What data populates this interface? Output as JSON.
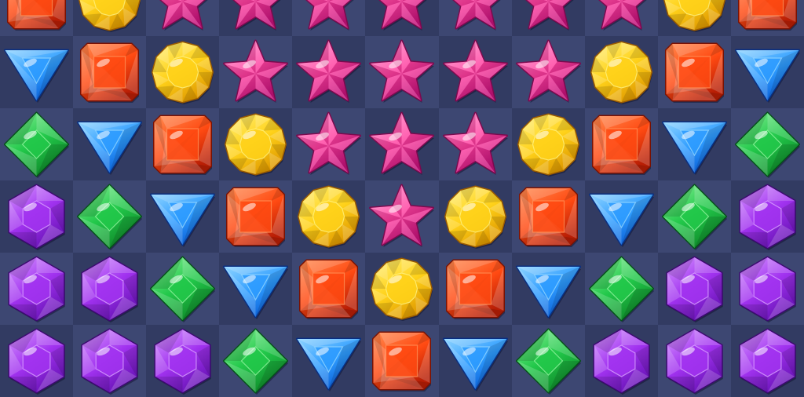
{
  "board": {
    "columns": 11,
    "rows": 6,
    "colors": {
      "cell_light": "#3d4772",
      "cell_dark": "#323b62",
      "background": "#2b3358"
    },
    "gem_types": {
      "red": {
        "icon": "red-square-gem-icon",
        "fill": "#ff4a12",
        "light": "#ff8a50",
        "dark": "#b81e05",
        "rim": "#7a1203"
      },
      "yellow": {
        "icon": "yellow-round-gem-icon",
        "fill": "#ffd21a",
        "light": "#fff07a",
        "dark": "#e09a00",
        "rim": "#9a5a00"
      },
      "pink": {
        "icon": "pink-star-gem-icon",
        "fill": "#ff3fa0",
        "light": "#ff9ad0",
        "dark": "#c4107a",
        "rim": "#7a0a4e"
      },
      "blue": {
        "icon": "blue-triangle-gem-icon",
        "fill": "#2e9cff",
        "light": "#8fd4ff",
        "dark": "#0b5ed6",
        "rim": "#0a2f80"
      },
      "green": {
        "icon": "green-diamond-gem-icon",
        "fill": "#22c84a",
        "light": "#8cf29a",
        "dark": "#0f8a2a",
        "rim": "#06501a"
      },
      "purple": {
        "icon": "purple-hexagon-gem-icon",
        "fill": "#a233f0",
        "light": "#d79bff",
        "dark": "#6a14b8",
        "rim": "#3c0a70"
      }
    },
    "grid": [
      [
        "red",
        "yellow",
        "pink",
        "pink",
        "pink",
        "pink",
        "pink",
        "pink",
        "pink",
        "yellow",
        "red"
      ],
      [
        "blue",
        "red",
        "yellow",
        "pink",
        "pink",
        "pink",
        "pink",
        "pink",
        "yellow",
        "red",
        "blue"
      ],
      [
        "green",
        "blue",
        "red",
        "yellow",
        "pink",
        "pink",
        "pink",
        "yellow",
        "red",
        "blue",
        "green"
      ],
      [
        "purple",
        "green",
        "blue",
        "red",
        "yellow",
        "pink",
        "yellow",
        "red",
        "blue",
        "green",
        "purple"
      ],
      [
        "purple",
        "purple",
        "green",
        "blue",
        "red",
        "yellow",
        "red",
        "blue",
        "green",
        "purple",
        "purple"
      ],
      [
        "purple",
        "purple",
        "purple",
        "green",
        "blue",
        "red",
        "blue",
        "green",
        "purple",
        "purple",
        "purple"
      ]
    ]
  }
}
